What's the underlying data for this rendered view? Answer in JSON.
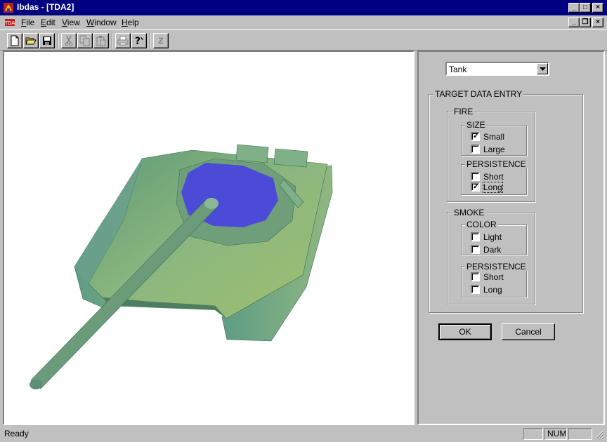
{
  "window": {
    "title": "Ibdas - [TDA2]",
    "controls": {
      "minimize": "_",
      "maximize": "□",
      "close": "×",
      "restore": "❐"
    }
  },
  "menu": {
    "items": [
      {
        "label": "File",
        "mnemonic": "F"
      },
      {
        "label": "Edit",
        "mnemonic": "E"
      },
      {
        "label": "View",
        "mnemonic": "V"
      },
      {
        "label": "Window",
        "mnemonic": "W"
      },
      {
        "label": "Help",
        "mnemonic": "H"
      }
    ]
  },
  "toolbar": {
    "buttons": [
      "new-icon",
      "open-icon",
      "save-icon",
      "cut-icon",
      "copy-icon",
      "paste-icon",
      "print-icon",
      "help-icon",
      "z-icon"
    ],
    "z_label": "Z"
  },
  "target_select": {
    "value": "Tank"
  },
  "target_entry": {
    "title": "TARGET DATA ENTRY",
    "fire": {
      "title": "FIRE",
      "size": {
        "title": "SIZE",
        "options": [
          {
            "label": "Small",
            "checked": true
          },
          {
            "label": "Large",
            "checked": false
          }
        ]
      },
      "persistence": {
        "title": "PERSISTENCE",
        "options": [
          {
            "label": "Short",
            "checked": false
          },
          {
            "label": "Long",
            "checked": true
          }
        ]
      }
    },
    "smoke": {
      "title": "SMOKE",
      "color": {
        "title": "COLOR",
        "options": [
          {
            "label": "Light",
            "checked": false
          },
          {
            "label": "Dark",
            "checked": false
          }
        ]
      },
      "persistence": {
        "title": "PERSISTENCE",
        "options": [
          {
            "label": "Short",
            "checked": false
          },
          {
            "label": "Long",
            "checked": false
          }
        ]
      }
    }
  },
  "buttons": {
    "ok": "OK",
    "cancel": "Cancel"
  },
  "status": {
    "text": "Ready",
    "num": "NUM"
  },
  "colors": {
    "titlebar": "#000080",
    "tank_body": "#6fa07a",
    "tank_hatch": "#4b4bd8"
  }
}
